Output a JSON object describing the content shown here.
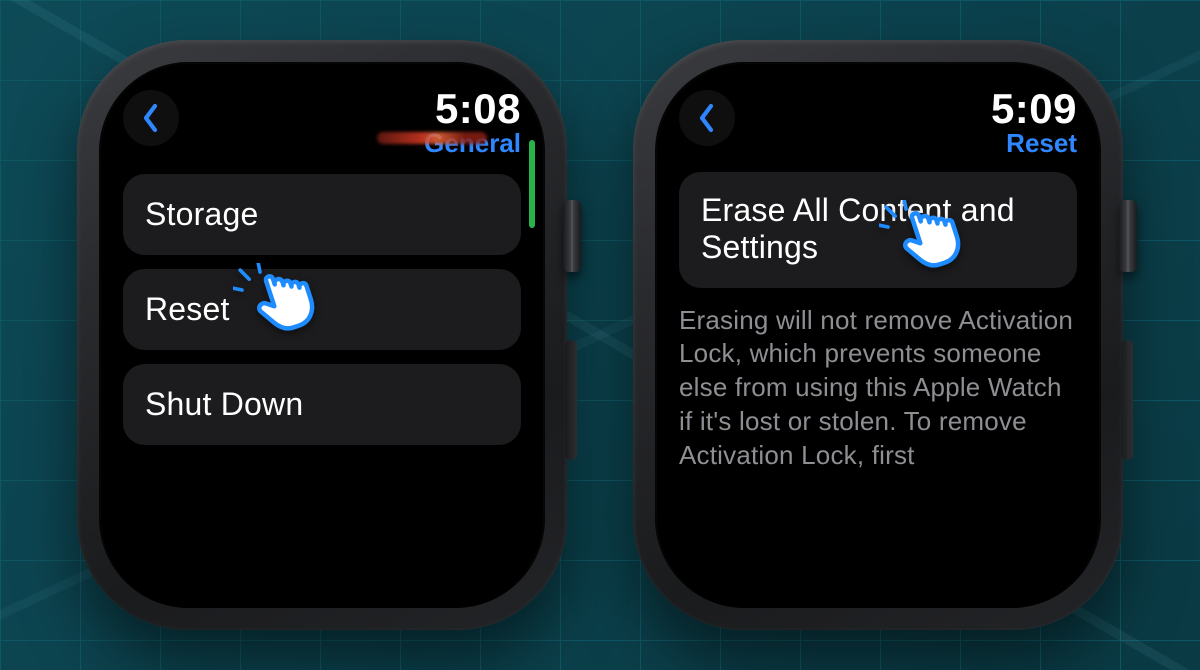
{
  "left": {
    "time": "5:08",
    "breadcrumb": "General",
    "items": [
      {
        "label": "Storage"
      },
      {
        "label": "Reset"
      },
      {
        "label": "Shut Down"
      }
    ]
  },
  "right": {
    "time": "5:09",
    "breadcrumb": "Reset",
    "erase_label": "Erase All Content and Settings",
    "desc": "Erasing will not remove Activation Lock, which prevents someone else from using this Apple Watch if it's lost or stolen. To remove Activation Lock, first"
  }
}
